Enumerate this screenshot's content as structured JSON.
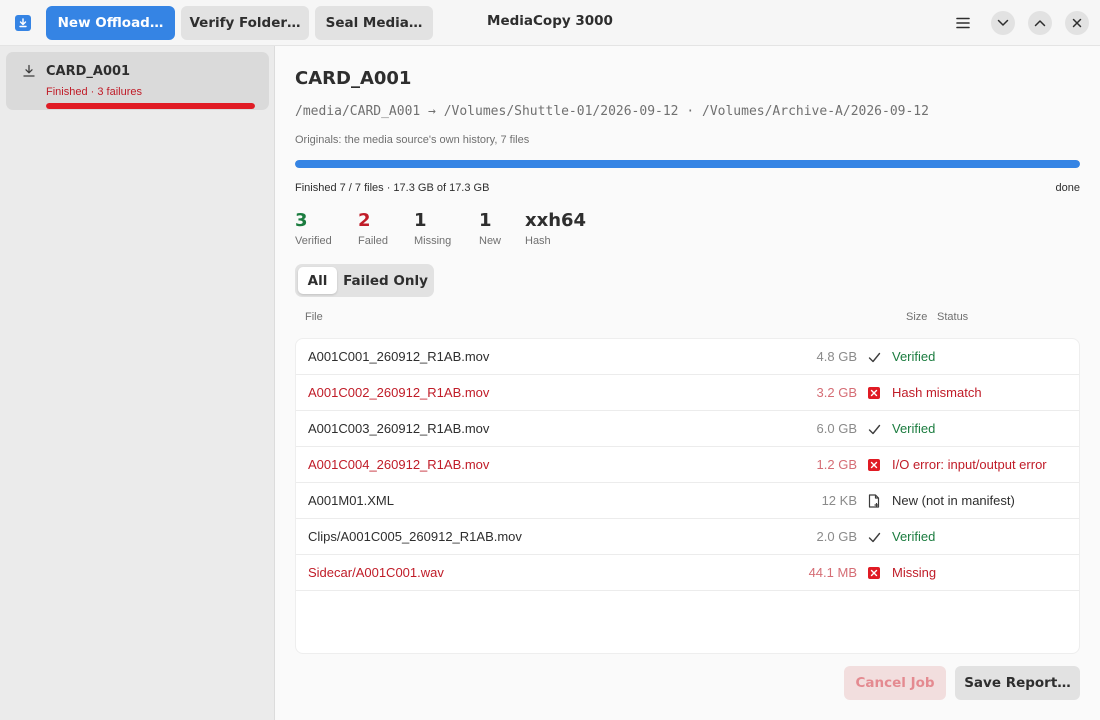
{
  "window": {
    "title": "MediaCopy 3000"
  },
  "toolbar": {
    "new_offload": "New Offload…",
    "verify_folder": "Verify Folder…",
    "seal_media": "Seal Media…"
  },
  "sidebar": {
    "jobs": [
      {
        "name": "CARD_A001",
        "status": "Finished · 3 failures",
        "progress": 1.0
      }
    ]
  },
  "job": {
    "title": "CARD_A001",
    "paths": "/media/CARD_A001 → /Volumes/Shuttle-01/2026-09-12 · /Volumes/Archive-A/2026-09-12",
    "subtitle": "Originals: the media source's own history, 7 files",
    "progress": 1.0,
    "progress_text": "Finished 7 / 7 files · 17.3 GB of 17.3 GB",
    "progress_state": "done",
    "stats": [
      {
        "value": "3",
        "label": "Verified",
        "color": "#1b7c3f"
      },
      {
        "value": "2",
        "label": "Failed",
        "color": "#c01c28"
      },
      {
        "value": "1",
        "label": "Missing",
        "color": "#2e2e2e"
      },
      {
        "value": "1",
        "label": "New",
        "color": "#2e2e2e"
      },
      {
        "value": "xxh64",
        "label": "Hash",
        "color": "#2e2e2e"
      }
    ]
  },
  "filter": {
    "all": "All",
    "failed_only": "Failed Only",
    "selected": "All"
  },
  "table": {
    "columns": {
      "file": "File",
      "size": "Size",
      "status": "Status"
    },
    "rows": [
      {
        "file": "A001C001_260912_R1AB.mov",
        "size": "4.8 GB",
        "status": "Verified",
        "kind": "ok",
        "icon": "check-icon"
      },
      {
        "file": "A001C002_260912_R1AB.mov",
        "size": "3.2 GB",
        "status": "Hash mismatch",
        "kind": "err",
        "icon": "error-icon"
      },
      {
        "file": "A001C003_260912_R1AB.mov",
        "size": "6.0 GB",
        "status": "Verified",
        "kind": "ok",
        "icon": "check-icon"
      },
      {
        "file": "A001C004_260912_R1AB.mov",
        "size": "1.2 GB",
        "status": "I/O error: input/output error",
        "kind": "err",
        "icon": "error-icon"
      },
      {
        "file": "A001M01.XML",
        "size": "12 KB",
        "status": "New (not in manifest)",
        "kind": "new",
        "icon": "new-file-icon"
      },
      {
        "file": "Clips/A001C005_260912_R1AB.mov",
        "size": "2.0 GB",
        "status": "Verified",
        "kind": "ok",
        "icon": "check-icon"
      },
      {
        "file": "Sidecar/A001C001.wav",
        "size": "44.1 MB",
        "status": "Missing",
        "kind": "err",
        "icon": "error-icon"
      }
    ]
  },
  "footer": {
    "cancel": "Cancel Job",
    "save_report": "Save Report…"
  },
  "colors": {
    "accent": "#3584e4",
    "error": "#c01c28",
    "success": "#1b7c3f"
  }
}
